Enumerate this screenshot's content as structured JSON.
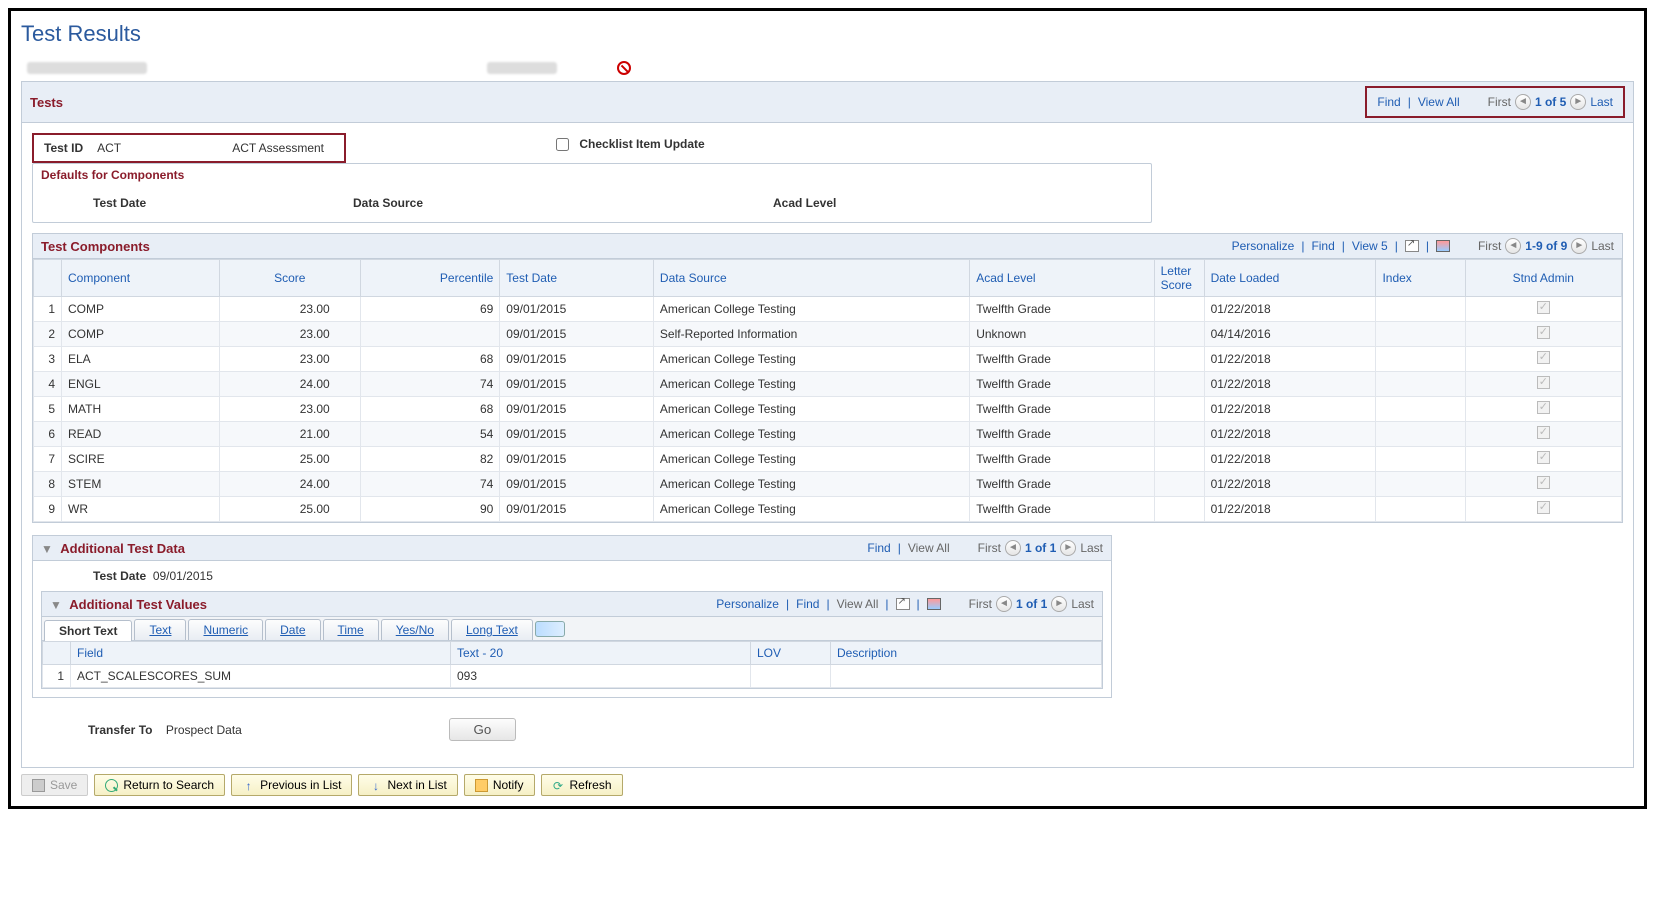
{
  "page_title": "Test Results",
  "tests_header": {
    "title": "Tests",
    "find": "Find",
    "view_all": "View All",
    "first": "First",
    "counter": "1 of 5",
    "last": "Last"
  },
  "test_id": {
    "label": "Test ID",
    "value": "ACT",
    "desc": "ACT Assessment"
  },
  "checklist_label": "Checklist Item Update",
  "defaults": {
    "title": "Defaults for Components",
    "col1": "Test Date",
    "col2": "Data Source",
    "col3": "Acad Level"
  },
  "components": {
    "title": "Test Components",
    "personalize": "Personalize",
    "find": "Find",
    "view": "View 5",
    "first": "First",
    "counter": "1-9 of 9",
    "last": "Last",
    "headers": {
      "num": "",
      "component": "Component",
      "score": "Score",
      "percentile": "Percentile",
      "test_date": "Test Date",
      "data_source": "Data Source",
      "acad_level": "Acad Level",
      "letter_score": "Letter Score",
      "date_loaded": "Date Loaded",
      "index": "Index",
      "stnd_admin": "Stnd Admin"
    },
    "rows": [
      {
        "n": "1",
        "component": "COMP",
        "score": "23.00",
        "pct": "69",
        "date": "09/01/2015",
        "source": "American College Testing",
        "level": "Twelfth Grade",
        "letter": "",
        "loaded": "01/22/2018",
        "index": ""
      },
      {
        "n": "2",
        "component": "COMP",
        "score": "23.00",
        "pct": "",
        "date": "09/01/2015",
        "source": "Self-Reported Information",
        "level": "Unknown",
        "letter": "",
        "loaded": "04/14/2016",
        "index": ""
      },
      {
        "n": "3",
        "component": "ELA",
        "score": "23.00",
        "pct": "68",
        "date": "09/01/2015",
        "source": "American College Testing",
        "level": "Twelfth Grade",
        "letter": "",
        "loaded": "01/22/2018",
        "index": ""
      },
      {
        "n": "4",
        "component": "ENGL",
        "score": "24.00",
        "pct": "74",
        "date": "09/01/2015",
        "source": "American College Testing",
        "level": "Twelfth Grade",
        "letter": "",
        "loaded": "01/22/2018",
        "index": ""
      },
      {
        "n": "5",
        "component": "MATH",
        "score": "23.00",
        "pct": "68",
        "date": "09/01/2015",
        "source": "American College Testing",
        "level": "Twelfth Grade",
        "letter": "",
        "loaded": "01/22/2018",
        "index": ""
      },
      {
        "n": "6",
        "component": "READ",
        "score": "21.00",
        "pct": "54",
        "date": "09/01/2015",
        "source": "American College Testing",
        "level": "Twelfth Grade",
        "letter": "",
        "loaded": "01/22/2018",
        "index": ""
      },
      {
        "n": "7",
        "component": "SCIRE",
        "score": "25.00",
        "pct": "82",
        "date": "09/01/2015",
        "source": "American College Testing",
        "level": "Twelfth Grade",
        "letter": "",
        "loaded": "01/22/2018",
        "index": ""
      },
      {
        "n": "8",
        "component": "STEM",
        "score": "24.00",
        "pct": "74",
        "date": "09/01/2015",
        "source": "American College Testing",
        "level": "Twelfth Grade",
        "letter": "",
        "loaded": "01/22/2018",
        "index": ""
      },
      {
        "n": "9",
        "component": "WR",
        "score": "25.00",
        "pct": "90",
        "date": "09/01/2015",
        "source": "American College Testing",
        "level": "Twelfth Grade",
        "letter": "",
        "loaded": "01/22/2018",
        "index": ""
      }
    ]
  },
  "additional": {
    "title": "Additional Test Data",
    "find": "Find",
    "view_all": "View All",
    "first": "First",
    "counter": "1 of 1",
    "last": "Last",
    "date_label": "Test Date",
    "date_value": "09/01/2015"
  },
  "values": {
    "title": "Additional Test Values",
    "personalize": "Personalize",
    "find": "Find",
    "view_all": "View All",
    "first": "First",
    "counter": "1 of 1",
    "last": "Last",
    "tabs": {
      "short_text": "Short Text",
      "text": "Text",
      "numeric": "Numeric",
      "date": "Date",
      "time": "Time",
      "yesno": "Yes/No",
      "long_text": "Long Text"
    },
    "headers": {
      "field": "Field",
      "text20": "Text - 20",
      "lov": "LOV",
      "desc": "Description"
    },
    "rows": [
      {
        "n": "1",
        "field": "ACT_SCALESCORES_SUM",
        "text": "093",
        "lov": "",
        "desc": ""
      }
    ]
  },
  "transfer": {
    "label": "Transfer To",
    "value": "Prospect Data",
    "go": "Go"
  },
  "buttons": {
    "save": "Save",
    "return": "Return to Search",
    "prev": "Previous in List",
    "next": "Next in List",
    "notify": "Notify",
    "refresh": "Refresh"
  }
}
